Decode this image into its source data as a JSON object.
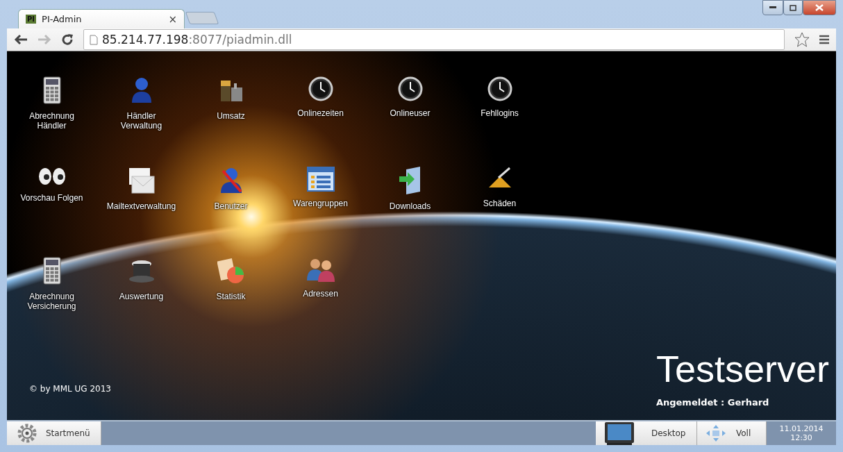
{
  "browser": {
    "favicon": "PI",
    "tab_title": "PI-Admin",
    "tab_close": "×",
    "url_host": "85.214.77.198",
    "url_rest": ":8077/piadmin.dll"
  },
  "desktop": {
    "icons": [
      {
        "label": "Abrechnung Händler",
        "kind": "calculator"
      },
      {
        "label": "Händler Verwaltung",
        "kind": "person"
      },
      {
        "label": "Umsatz",
        "kind": "battery"
      },
      {
        "label": "Onlinezeiten",
        "kind": "clock"
      },
      {
        "label": "Onlineuser",
        "kind": "clock"
      },
      {
        "label": "Fehllogins",
        "kind": "clock"
      },
      {
        "label": "Vorschau Folgen",
        "kind": "eyes"
      },
      {
        "label": "Mailtextverwaltung",
        "kind": "mail"
      },
      {
        "label": "Benutzer",
        "kind": "user-edit"
      },
      {
        "label": "Warengruppen",
        "kind": "list"
      },
      {
        "label": "Downloads",
        "kind": "download"
      },
      {
        "label": "Schäden",
        "kind": "tool"
      },
      {
        "label": "Abrechnung Versicherung",
        "kind": "calculator"
      },
      {
        "label": "Auswertung",
        "kind": "hat"
      },
      {
        "label": "Statistik",
        "kind": "chart"
      },
      {
        "label": "Adressen",
        "kind": "people"
      }
    ],
    "copyright": "© by MML UG 2013",
    "title": "Testserver",
    "login": "Angemeldet : Gerhard"
  },
  "taskbar": {
    "start": "Startmenü",
    "buttons": [
      {
        "label": "Desktop",
        "kind": "monitor"
      },
      {
        "label": "Voll",
        "kind": "move"
      }
    ],
    "date": "11.01.2014",
    "time": "12:30"
  }
}
